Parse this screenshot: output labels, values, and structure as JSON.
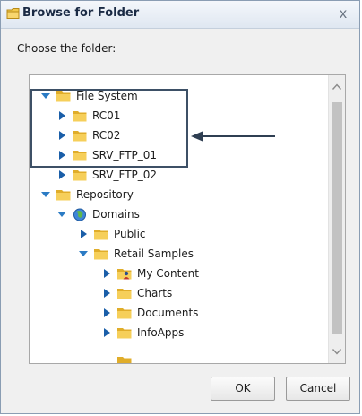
{
  "window": {
    "title": "Browse for Folder",
    "close_glyph": "x"
  },
  "prompt": "Choose the folder:",
  "tree": [
    {
      "label": "File System",
      "expanded": true,
      "icon": "folder-icon"
    },
    {
      "label": "RC01",
      "expanded": false,
      "icon": "folder-icon"
    },
    {
      "label": "RC02",
      "expanded": false,
      "icon": "folder-icon"
    },
    {
      "label": "SRV_FTP_01",
      "expanded": false,
      "icon": "folder-icon"
    },
    {
      "label": "SRV_FTP_02",
      "expanded": false,
      "icon": "folder-icon"
    },
    {
      "label": "Repository",
      "expanded": true,
      "icon": "folder-icon"
    },
    {
      "label": "Domains",
      "expanded": true,
      "icon": "globe-icon"
    },
    {
      "label": "Public",
      "expanded": false,
      "icon": "folder-icon"
    },
    {
      "label": "Retail Samples",
      "expanded": true,
      "icon": "folder-icon"
    },
    {
      "label": "My Content",
      "expanded": false,
      "icon": "user-folder-icon"
    },
    {
      "label": "Charts",
      "expanded": false,
      "icon": "folder-icon"
    },
    {
      "label": "Documents",
      "expanded": false,
      "icon": "folder-icon"
    },
    {
      "label": "InfoApps",
      "expanded": false,
      "icon": "folder-icon"
    }
  ],
  "buttons": {
    "ok": "OK",
    "cancel": "Cancel"
  },
  "colors": {
    "folder": "#f2c94c",
    "twisty_expanded": "#2b7bc4",
    "twisty_collapsed": "#1a5ea8",
    "highlight": "#3d5066"
  }
}
